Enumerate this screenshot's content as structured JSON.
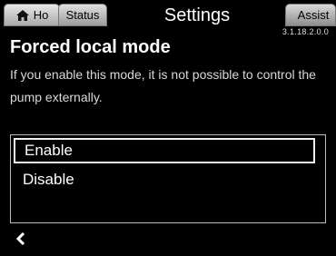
{
  "header": {
    "home_tab_label": "Ho",
    "status_tab_label": "Status",
    "title": "Settings",
    "assist_tab_label": "Assist",
    "version": "3.1.18.2.0.0"
  },
  "page": {
    "heading": "Forced local mode",
    "description": "If you enable this mode, it is not possible to control the pump externally."
  },
  "options": [
    {
      "label": "Enable",
      "selected": true
    },
    {
      "label": "Disable",
      "selected": false
    }
  ],
  "icons": {
    "home": "home-icon",
    "back": "chevron-left-icon"
  }
}
